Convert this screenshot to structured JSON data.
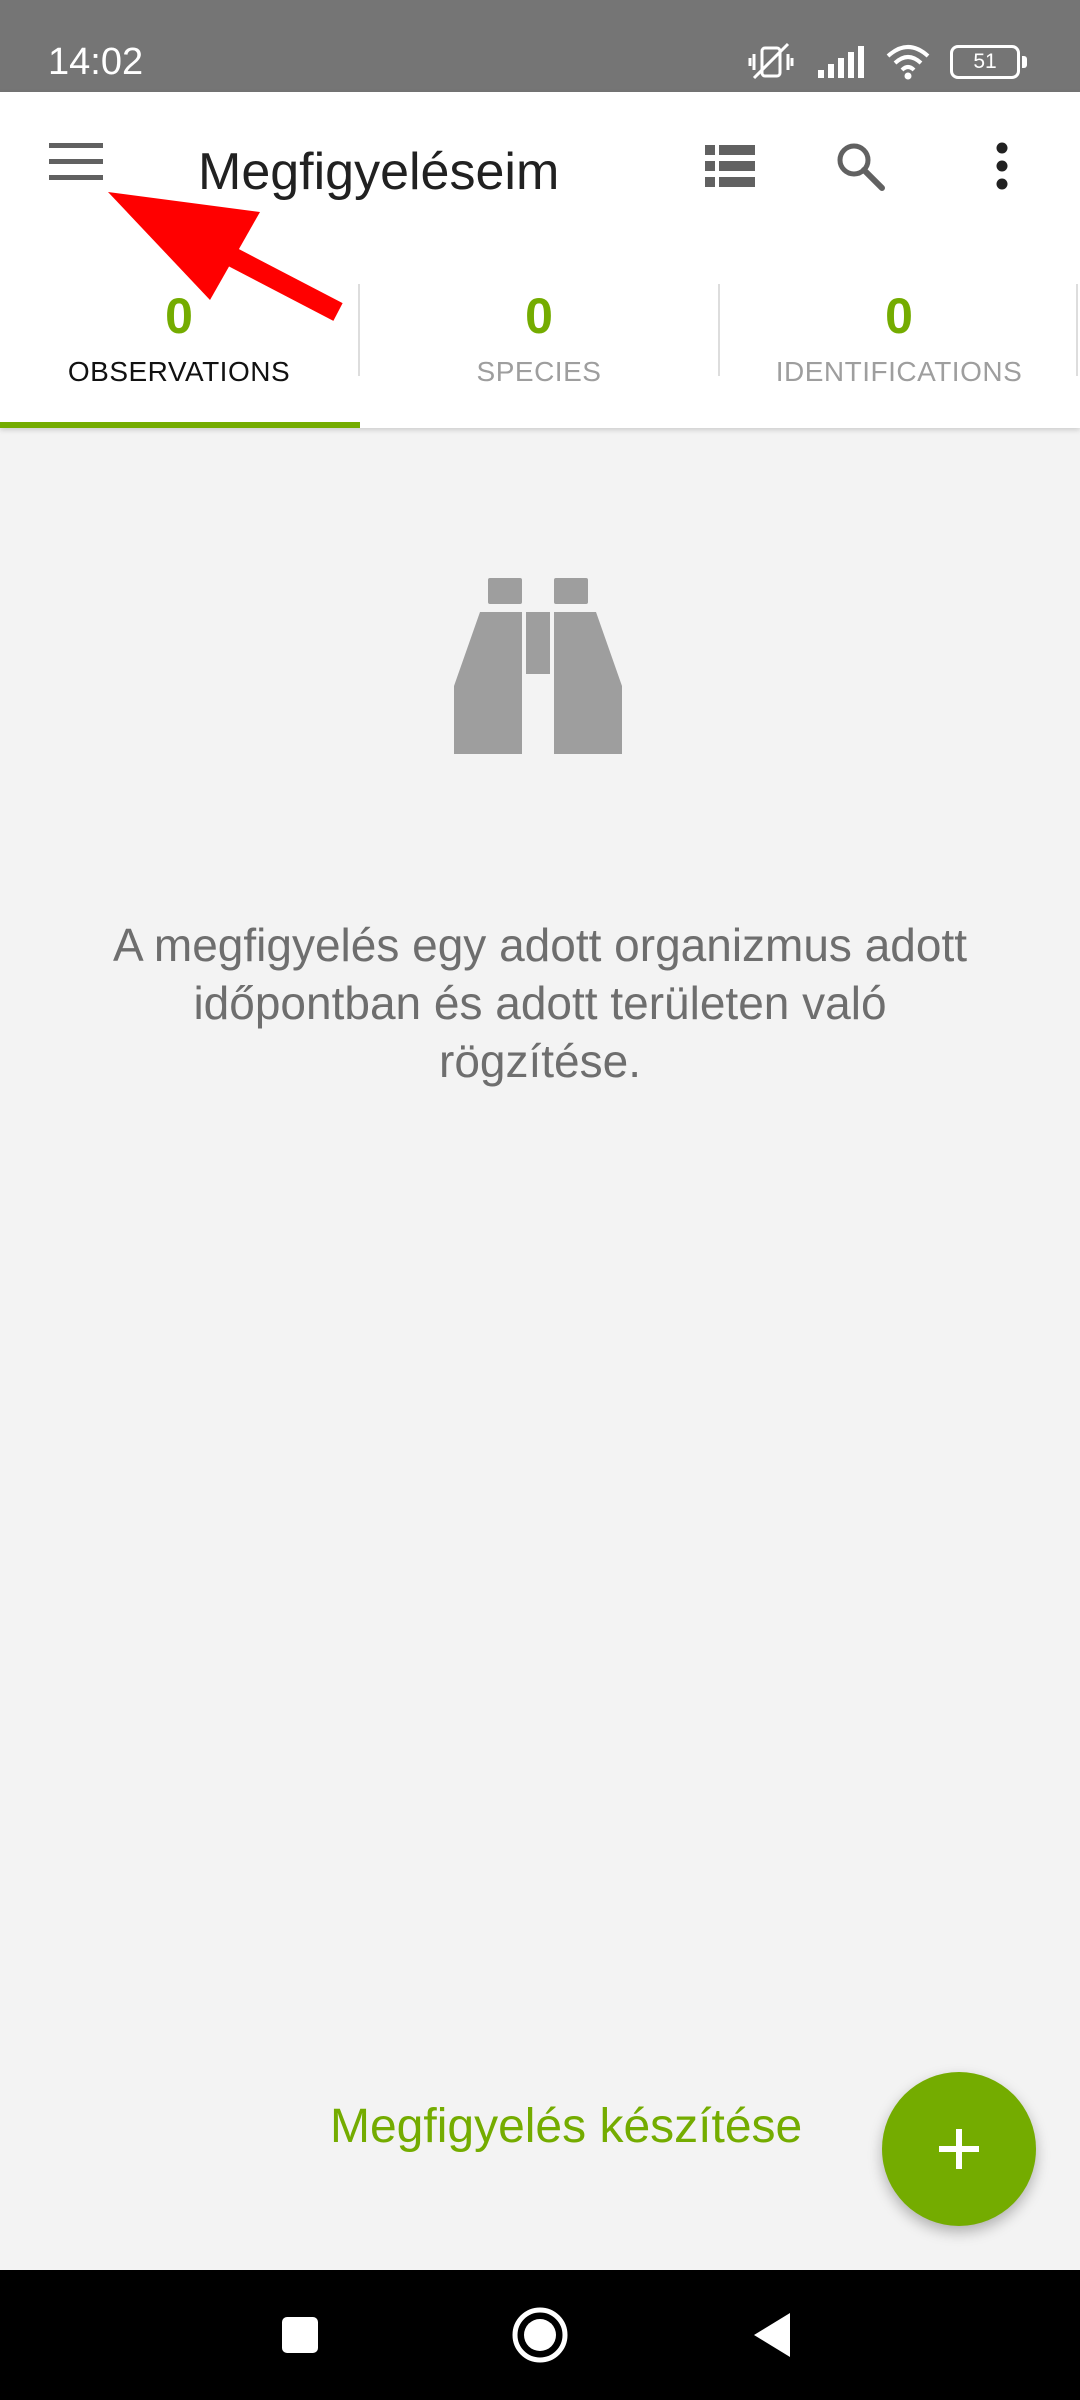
{
  "status_bar": {
    "time": "14:02",
    "battery_level": "51",
    "icons": [
      "mute-vibrate-icon",
      "signal-icon",
      "wifi-icon",
      "battery-icon"
    ]
  },
  "app_bar": {
    "title": "Megfigyeléseim",
    "icons": [
      "menu-icon",
      "list-view-icon",
      "search-icon",
      "more-vert-icon"
    ]
  },
  "tabs": [
    {
      "count": "0",
      "label": "OBSERVATIONS",
      "active": true
    },
    {
      "count": "0",
      "label": "SPECIES",
      "active": false
    },
    {
      "count": "0",
      "label": "IDENTIFICATIONS",
      "active": false
    }
  ],
  "empty_state": {
    "icon": "binoculars-icon",
    "message": "A megfigyelés egy adott organizmus adott időpontban és adott területen való rögzítése."
  },
  "create_observation": {
    "label": "Megfigyelés készítése",
    "fab_icon": "plus-icon"
  },
  "nav_bar": {
    "icons": [
      "recents-icon",
      "home-icon",
      "back-icon"
    ]
  },
  "colors": {
    "accent": "#74ac00",
    "status_bar": "#757575",
    "background": "#f3f3f3",
    "annotation_arrow": "#ff0000"
  }
}
